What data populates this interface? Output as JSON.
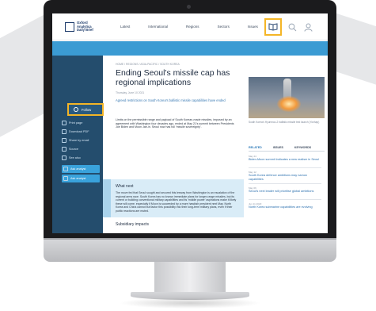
{
  "site": {
    "logo_text": "Oxford\nAnalytica\nDaily Brief"
  },
  "topnav": {
    "items": [
      "Latest",
      "International",
      "Regions",
      "Sectors",
      "Issues"
    ],
    "icons": [
      "book-open-icon",
      "search-icon",
      "user-icon"
    ]
  },
  "breadcrumb": "HOME / REGIONS / ASIA-PACIFIC / SOUTH KOREA",
  "article": {
    "title": "Ending Seoul's missile cap has regional implications",
    "date": "Thursday, June 10 2021",
    "dek": "Agreed restrictions on South Korea's ballistic missile capabilities have ended",
    "body": "Limits on the permissible range and payload of South Korean-made missiles, imposed by an agreement with Washington four decades ago, ended at May 21's summit between Presidents Joe Biden and Moon Jae-in. Seoul now has full 'missile sovereignty'.",
    "what_next_heading": "What next",
    "what_next_body": "The move fed that Seoul sought and secured this leeway from Washington is an escalation of the regional arms race. South Korea has no known immediate plans for longer-range missiles, but its current or building conventional military capabilities and its 'middle power' aspirations make it likely these will come, especially if Moon is succeeded by a more hawkish president next May. North Korea and China cannot but factor this possibility into their long-term military plans, even if their public reactions are muted.",
    "subsidiary_heading": "Subsidiary impacts"
  },
  "sidebar": {
    "follow": "Follow",
    "items": [
      "Print page",
      "Download PDF",
      "Share by email",
      "Source",
      "See also"
    ],
    "buttons": [
      "Ask analyst",
      "Ask analyst"
    ]
  },
  "right": {
    "caption": "South Korea's Hyunmoo-2 ballistic missile test launch (Yonhap)",
    "tabs": [
      "RELATED",
      "ISSUES",
      "KEYWORDS"
    ],
    "related": [
      {
        "date": "May 24",
        "title": "Biden-Moon summit indicates a new realism in Seoul"
      },
      {
        "date": "May 12",
        "title": "South Korea defence ambitions may narrow capabilities"
      },
      {
        "date": "May 06",
        "title": "Seoul's next leader will prioritise global ambitions"
      },
      {
        "date": "Jun 11 2020",
        "title": "North Korea submarine capabilities are evolving"
      }
    ]
  },
  "colors": {
    "highlight": "#f4b526",
    "banner": "#3b9bd3",
    "sidebar": "#244d6d",
    "whatnext": "#d9ecf7"
  }
}
